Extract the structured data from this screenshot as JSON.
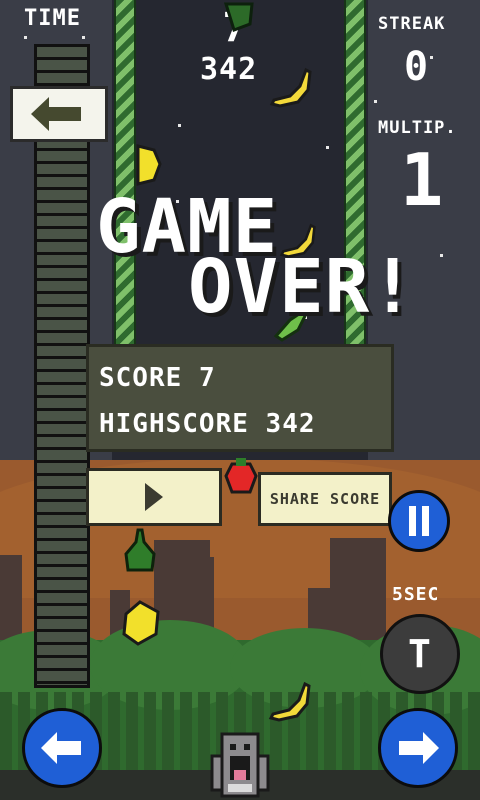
{
  "hud": {
    "time_label": "TIME",
    "streak_label": "STREAK",
    "streak_value": "0",
    "multiplier_label": "MULTIP.",
    "multiplier_value": "1",
    "current_score": "7",
    "best_score": "342",
    "timer_label": "5SEC",
    "time_remaining_fraction": 1.0
  },
  "gameover": {
    "line1": "GAME",
    "line2": "OVER!",
    "score_label": "SCORE",
    "score_value": "7",
    "highscore_label": "HIGHSCORE",
    "highscore_value": "342",
    "share_label": "SHARE SCORE"
  },
  "buttons": {
    "back_icon": "arrow-left-icon",
    "play_icon": "play-icon",
    "pause_icon": "pause-icon",
    "timer_icon_text": "T",
    "left_icon": "arrow-left-icon",
    "right_icon": "arrow-right-icon"
  },
  "colors": {
    "blue_button": "#1f5fd6",
    "cream_button": "#f3f1c9",
    "dark_button": "#3c3c3c",
    "panel_grey": "#3a3d47"
  },
  "fruits": [
    "banana",
    "lemon",
    "banana",
    "leaf",
    "strawberry",
    "pear",
    "lemon",
    "banana"
  ]
}
